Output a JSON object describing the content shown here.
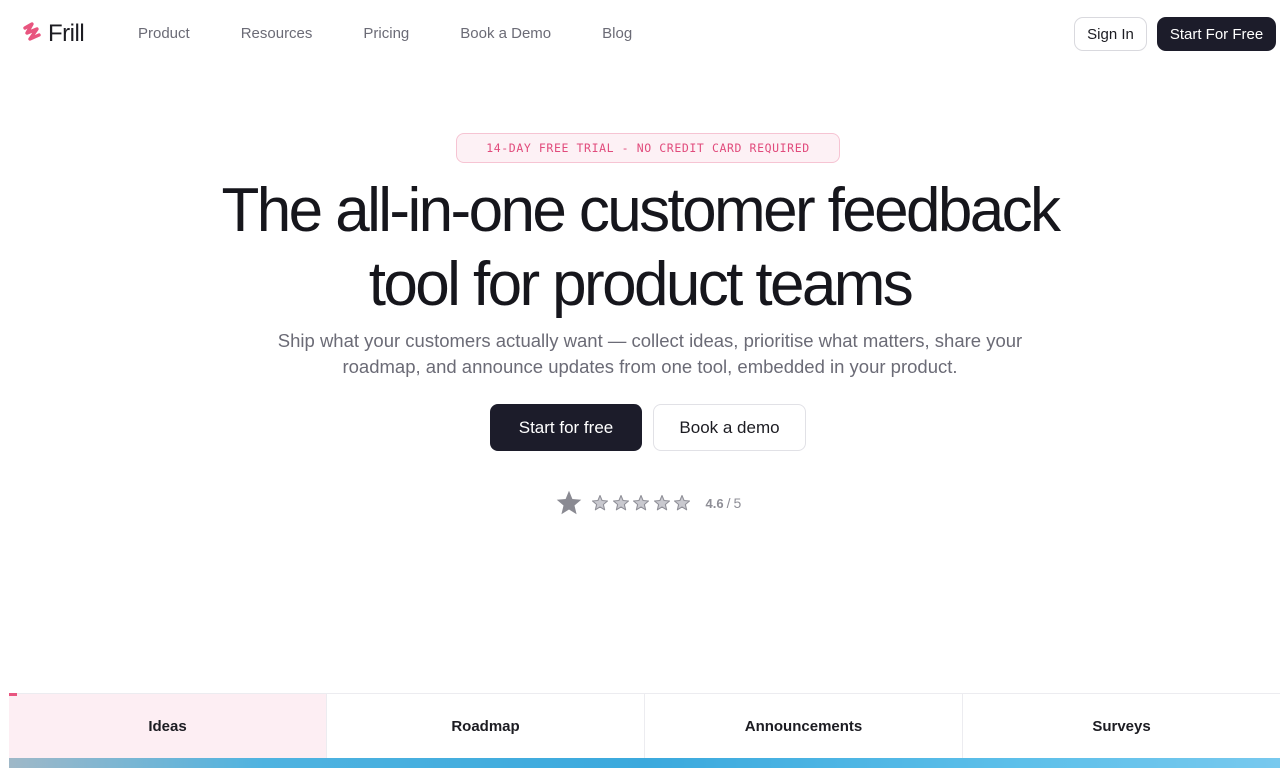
{
  "brand": {
    "name": "Frill",
    "accent": "#e8557f"
  },
  "nav": {
    "links": [
      "Product",
      "Resources",
      "Pricing",
      "Book a Demo",
      "Blog"
    ],
    "sign_in": "Sign In",
    "start": "Start For Free"
  },
  "hero": {
    "badge": "14-DAY FREE TRIAL - NO CREDIT CARD REQUIRED",
    "headline_line1": "The all-in-one customer feedback",
    "headline_line2": "tool for product teams",
    "subhead_line1": "Ship what your customers actually want — collect ideas, prioritise what matters, share your",
    "subhead_line2": "roadmap, and announce updates from one tool, embedded in your product.",
    "cta_primary": "Start for free",
    "cta_secondary": "Book a demo",
    "rating": {
      "score": "4.6",
      "separator": "/",
      "max": "5",
      "stars": 5
    }
  },
  "tabs": [
    {
      "label": "Ideas",
      "active": true
    },
    {
      "label": "Roadmap",
      "active": false
    },
    {
      "label": "Announcements",
      "active": false
    },
    {
      "label": "Surveys",
      "active": false
    }
  ],
  "icons": {
    "logo": "frill-logo-icon",
    "rating_badge": "star-icon",
    "rating_stars": "star-outline-icon"
  },
  "colors": {
    "primary_dark": "#1c1c2a",
    "badge_text": "#e14b7c",
    "badge_bg": "#fdf1f5",
    "tab_active_bg": "#fdeef3"
  }
}
